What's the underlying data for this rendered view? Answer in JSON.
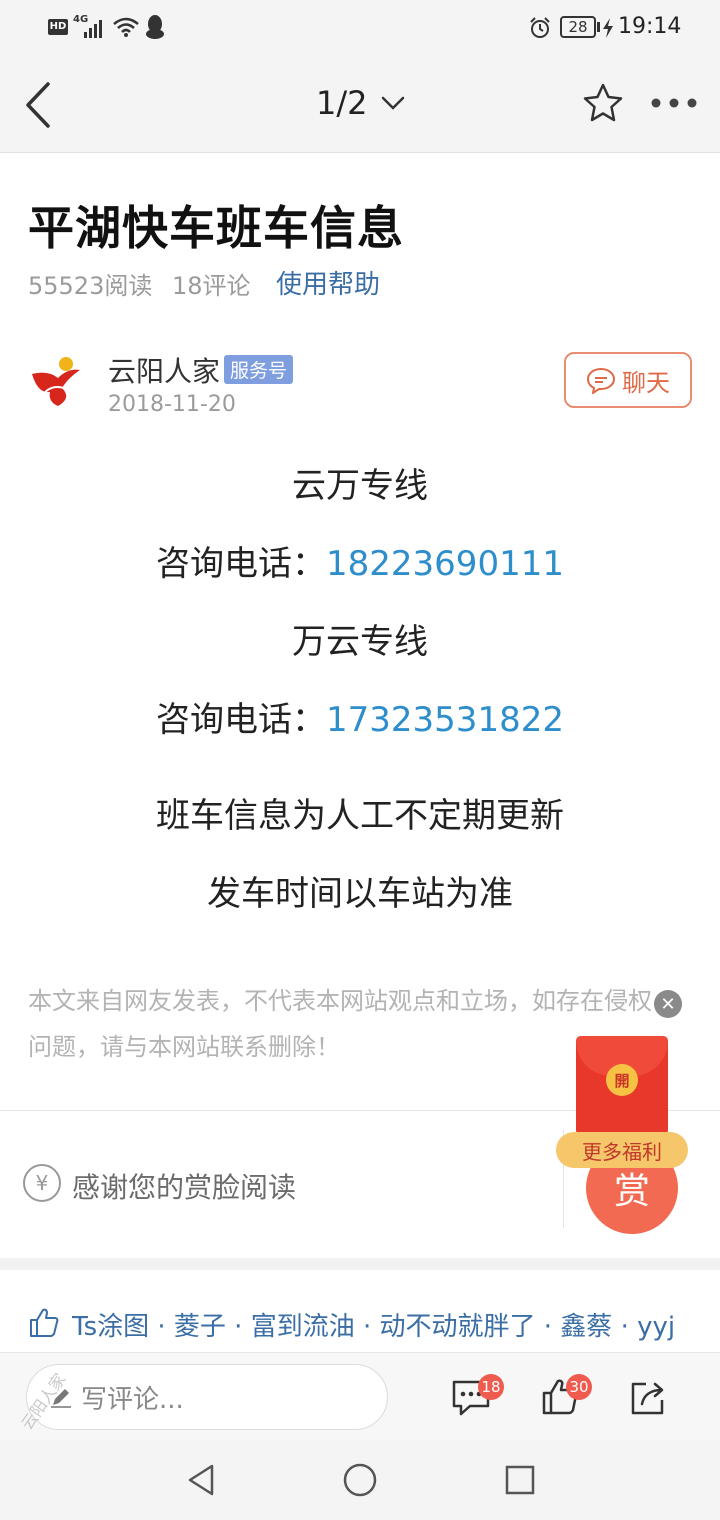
{
  "status_bar": {
    "left_icons": [
      "hd-icon",
      "4g-signal-icon",
      "wifi-icon",
      "qq-icon"
    ],
    "hd_label": "HD",
    "network": "4G",
    "battery": "28",
    "time": "19:14"
  },
  "header": {
    "page_indicator": "1/2"
  },
  "article": {
    "title": "平湖快车班车信息",
    "reads": "55523阅读",
    "comments": "18评论",
    "help_link": "使用帮助",
    "author": "云阳人家",
    "author_badge": "服务号",
    "date": "2018-11-20",
    "chat_button": "聊天",
    "lines": [
      {
        "label": "云万专线"
      },
      {
        "label": "咨询电话：",
        "phone": "18223690111"
      },
      {
        "label": "万云专线"
      },
      {
        "label": "咨询电话：",
        "phone": "17323531822"
      },
      {
        "label": "班车信息为人工不定期更新"
      },
      {
        "label": "发车时间以车站为准"
      }
    ],
    "disclaimer": "本文来自网友发表，不代表本网站观点和立场，如存在侵权问题，请与本网站联系删除！"
  },
  "reward": {
    "text": "感谢您的赏脸阅读",
    "currency_symbol": "¥",
    "button": "赏",
    "redpacket_open": "開",
    "redpacket_label": "更多福利"
  },
  "likes": {
    "names_line": "Ts涂图 · 菱子 · 富到流油 · 动不动就胖了 · 鑫蔡 · yyj"
  },
  "bottom_bar": {
    "comment_placeholder": "写评论...",
    "comment_count": "18",
    "like_count": "30"
  },
  "watermark": "云阳人家",
  "colors": {
    "accent_blue": "#2d8ecb",
    "link_blue": "#3b6ea5",
    "red": "#f05b4f",
    "chat_orange": "#e06a48"
  }
}
